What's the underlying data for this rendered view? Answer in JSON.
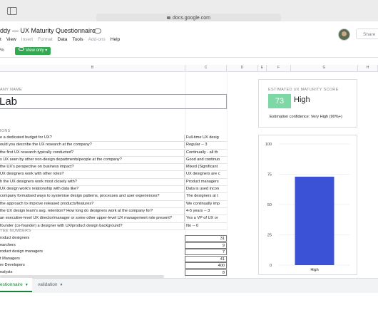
{
  "browser": {
    "url": "docs.google.com"
  },
  "doc": {
    "title": "ddy — UX Maturity Questionnaire"
  },
  "menu": {
    "items": [
      "t",
      "View",
      "Insert",
      "Format",
      "Data",
      "Tools",
      "Add-ons",
      "Help"
    ]
  },
  "header": {
    "share_label": "Share"
  },
  "toolbar": {
    "zoom": "%",
    "view_only_label": "View only"
  },
  "columns": [
    "B",
    "C",
    "D",
    "E",
    "F",
    "G",
    "H"
  ],
  "company": {
    "section_label": "ANY NAME",
    "name": "Lab"
  },
  "questions": {
    "section_label": "IONS",
    "rows": [
      {
        "q": "e a dedicated budget for UX?",
        "a": "Full-time UX desig"
      },
      {
        "q": "ould you describe the UX research at the company?",
        "a": "Regular -- 3"
      },
      {
        "q": "the first UX research typically conducted?",
        "a": "Continually - all th"
      },
      {
        "q": "s UX seen by other non-design departments/people at the company?",
        "a": "Good and continuo"
      },
      {
        "q": "the UX's perspective on business impact?",
        "a": "Mixed (Significant"
      },
      {
        "q": "UX designers work with other roles?",
        "a": "UX designers are c"
      },
      {
        "q": "h the UX designers work most closely with?",
        "a": "Product managers"
      },
      {
        "q": "UX design work's relationship with data like?",
        "a": "Data is used incon"
      },
      {
        "q": "company formalised ways to systemise design patterns, processes and user experiences?",
        "a": "The designers at t"
      },
      {
        "q": "the approach to improve released products/features?",
        "a": "We continually imp"
      },
      {
        "q": "the UX design team's avg. retention? How long do designers work at the company for?",
        "a": "4-5 years -- 3"
      },
      {
        "q": "an executive-level UX director/manager or some other upper-level UX management role present?",
        "a": "Yes a VP of UX or"
      },
      {
        "q": "founder (co-founder) a designer with UX/product design background?",
        "a": "No -- 0"
      }
    ]
  },
  "employees": {
    "section_label": "YEE NUMBERS",
    "rows": [
      {
        "label": "roduct designers",
        "value": "31"
      },
      {
        "label": "earchers",
        "value": "9"
      },
      {
        "label": "roduct design managers",
        "value": "7"
      },
      {
        "label": "t Managers",
        "value": "41"
      },
      {
        "label": "re Developers",
        "value": "400"
      },
      {
        "label": "nalysts",
        "value": "8"
      }
    ]
  },
  "score": {
    "title": "ESTIMATED UX MATURITY SCORE",
    "value": "73",
    "level": "High",
    "confidence": "Estimation confidence: Very High (90%+)"
  },
  "chart_data": {
    "type": "bar",
    "categories": [
      "High"
    ],
    "values": [
      73
    ],
    "ylim": [
      0,
      100
    ],
    "yticks": [
      "0",
      "25",
      "50",
      "75",
      "100"
    ],
    "color": "#3b51d6",
    "grid": true
  },
  "tabs": {
    "active": "estionnaire",
    "inactive": "validation"
  }
}
